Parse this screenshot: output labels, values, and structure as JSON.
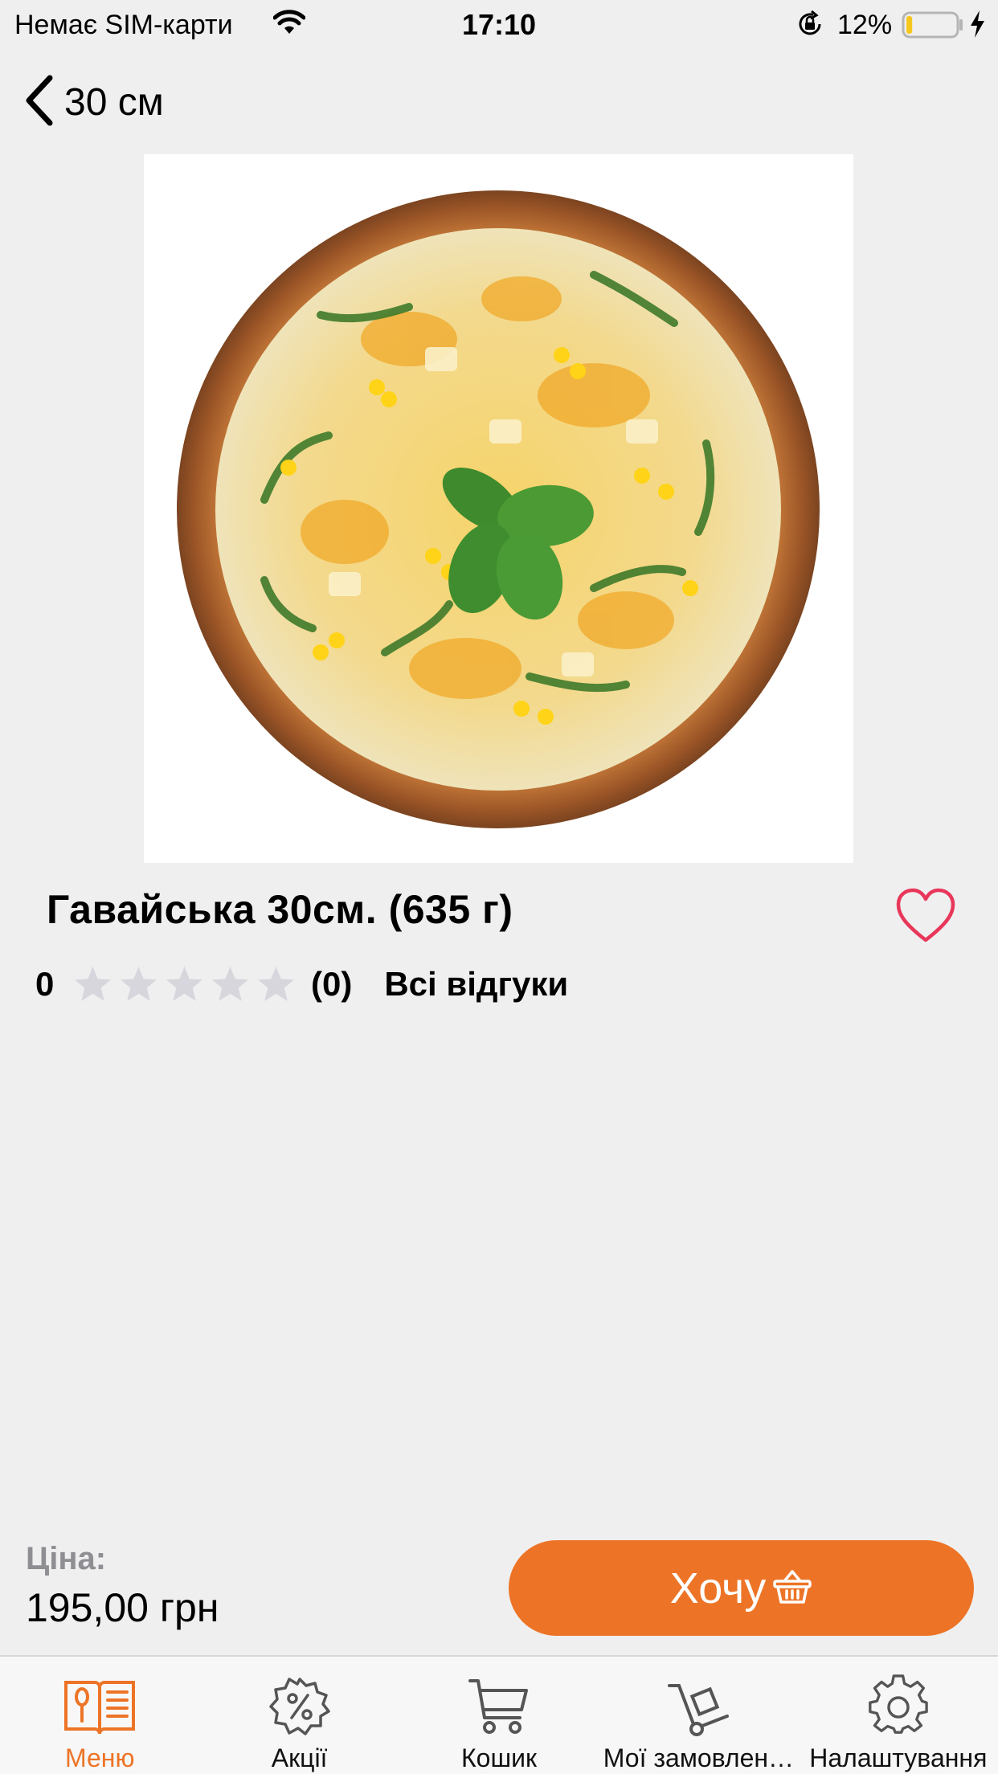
{
  "status_bar": {
    "carrier": "Немає SIM-карти",
    "time": "17:10",
    "battery_percent": "12%",
    "battery_level": 0.12
  },
  "nav": {
    "back_label": "30 см"
  },
  "product": {
    "title": "Гавайська 30см. (635 г)",
    "rating_value": "0",
    "stars_filled": 0,
    "stars_total": 5,
    "rating_count": "(0)",
    "all_reviews_label": "Всі відгуки",
    "favorite": false
  },
  "price": {
    "label": "Ціна:",
    "value": "195,00 грн"
  },
  "cta": {
    "label": "Хочу"
  },
  "tab_bar": {
    "items": [
      {
        "label": "Меню",
        "icon": "menu-book-icon",
        "active": true
      },
      {
        "label": "Акції",
        "icon": "discount-gear-icon",
        "active": false
      },
      {
        "label": "Кошик",
        "icon": "cart-icon",
        "active": false
      },
      {
        "label": "Мої замовлен…",
        "icon": "hand-truck-icon",
        "active": false
      },
      {
        "label": "Налаштування",
        "icon": "settings-gear-icon",
        "active": false
      }
    ]
  },
  "colors": {
    "accent": "#ed7426",
    "heart": "#e8375a",
    "star_empty": "#d6d6dc",
    "background": "#efeff0"
  }
}
